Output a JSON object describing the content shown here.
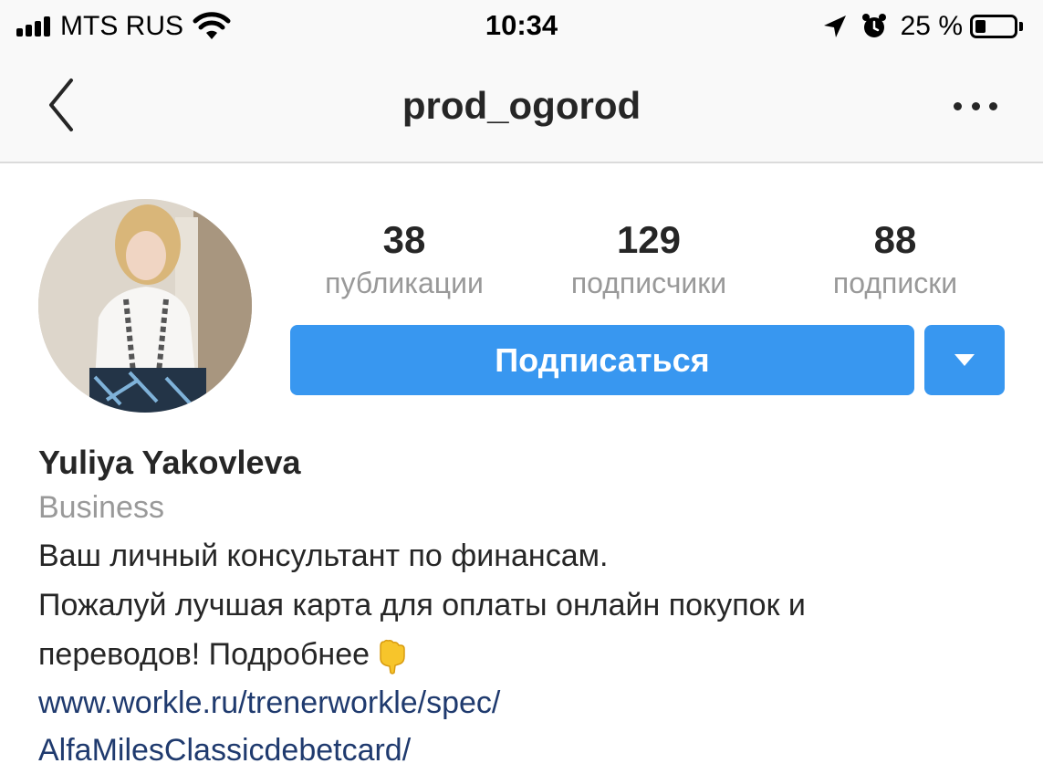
{
  "status_bar": {
    "carrier": "MTS RUS",
    "time": "10:34",
    "battery_percent": "25 %",
    "battery_level": 0.25,
    "icons": [
      "signal-icon",
      "wifi-icon",
      "location-arrow-icon",
      "alarm-icon",
      "battery-icon"
    ]
  },
  "nav": {
    "title": "prod_ogorod",
    "icons": [
      "back-chevron-icon",
      "more-options-icon"
    ]
  },
  "profile": {
    "avatar_icon": "profile-photo",
    "stats": {
      "posts_count": "38",
      "posts_label": "публикации",
      "followers_count": "129",
      "followers_label": "подписчики",
      "following_count": "88",
      "following_label": "подписки"
    },
    "follow_button": "Подписаться",
    "dropdown_icon": "triangle-down-icon"
  },
  "bio": {
    "name": "Yuliya Yakovleva",
    "category": "Business",
    "line1": "Ваш личный консультант по финансам.",
    "line2": "Пожалуй лучшая карта для оплаты онлайн покупок и",
    "line3": "переводов! Подробнее",
    "emoji_icon": "backhand-index-pointing-down-emoji",
    "link_line1": "www.workle.ru/trenerworkle/spec/",
    "link_line2": "AlfaMilesClassicdebetcard/"
  },
  "colors": {
    "accent_blue": "#3897f0",
    "link_blue": "#1f3a6e",
    "muted_gray": "#999999",
    "text_dark": "#262626",
    "bar_bg": "#f9f9f9"
  }
}
